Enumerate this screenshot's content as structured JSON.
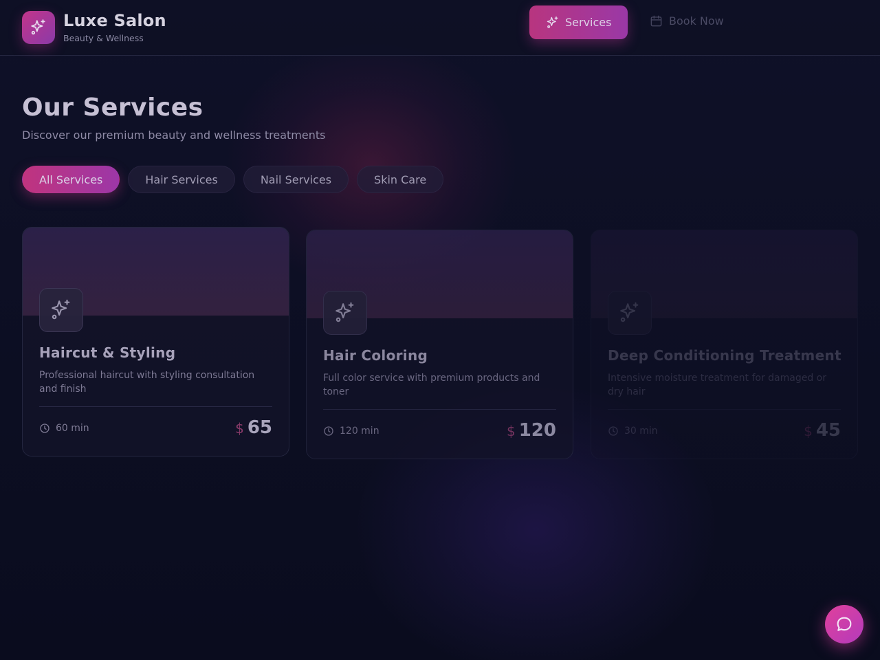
{
  "brand": {
    "name": "Luxe Salon",
    "tagline": "Beauty & Wellness",
    "logo_icon": "sparkles-icon"
  },
  "nav": {
    "services_label": "Services",
    "services_icon": "sparkles-icon",
    "book_label": "Book Now",
    "book_icon": "calendar-icon"
  },
  "page": {
    "title": "Our Services",
    "subtitle": "Discover our premium beauty and wellness treatments"
  },
  "filters": [
    {
      "label": "All Services",
      "active": true
    },
    {
      "label": "Hair Services",
      "active": false
    },
    {
      "label": "Nail Services",
      "active": false
    },
    {
      "label": "Skin Care",
      "active": false
    }
  ],
  "services": [
    {
      "name": "Haircut & Styling",
      "description": "Professional haircut with styling consultation and finish",
      "duration": "60 min",
      "currency": "$",
      "price": "65",
      "icon": "sparkles-icon"
    },
    {
      "name": "Hair Coloring",
      "description": "Full color service with premium products and toner",
      "duration": "120 min",
      "currency": "$",
      "price": "120",
      "icon": "sparkles-icon"
    },
    {
      "name": "Deep Conditioning Treatment",
      "description": "Intensive moisture treatment for damaged or dry hair",
      "duration": "30 min",
      "currency": "$",
      "price": "45",
      "icon": "sparkles-icon"
    }
  ],
  "chat_button": {
    "icon": "chat-bubble-icon"
  },
  "colors": {
    "accent_pink": "#c2358a",
    "accent_purple": "#9a38a6",
    "background": "#0d0f22"
  }
}
